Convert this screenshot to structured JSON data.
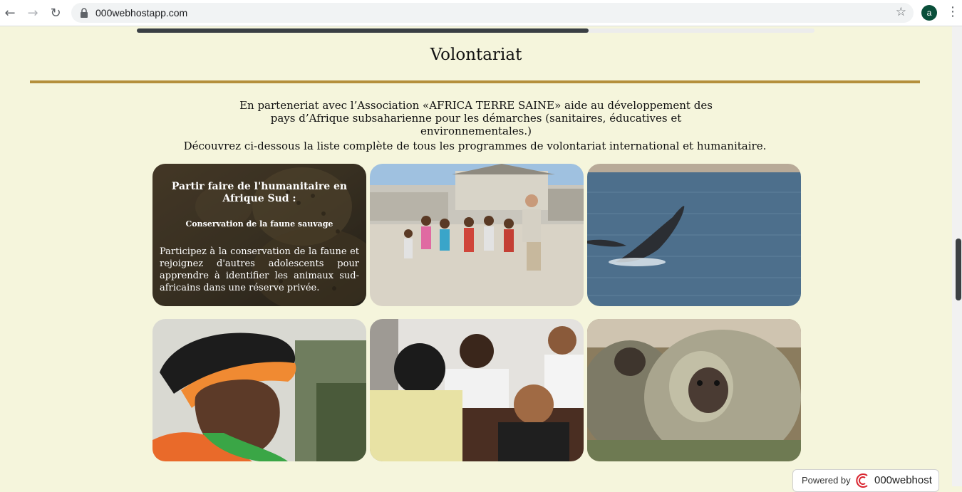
{
  "browser": {
    "back_icon": "←",
    "forward_icon": "→",
    "reload_icon": "↻",
    "url": "000webhostapp.com",
    "star_icon": "☆",
    "profile_initial": "a",
    "menu_icon": "⋮"
  },
  "page": {
    "progress_fraction": 0.667,
    "title": "Volontariat",
    "intro": "En parteneriat avec l’Association «AFRICA TERRE SAINE» aide au développement des pays d’Afrique subsaharienne pour les démarches (sanitaires, éducatives et environnementales.)",
    "discover": "Découvrez ci-dessous la liste complète de tous les programmes de volontariat international et humanitaire."
  },
  "cards": [
    {
      "title": "Partir faire de l'humanitaire en Afrique Sud :",
      "subtitle": "Conservation de la faune sauvage",
      "description": "Participez à la conservation de la faune et rejoignez d'autres adolescents pour apprendre à identifier les animaux sud-africains dans une réserve privée."
    }
  ],
  "footer": {
    "powered_by": "Powered by",
    "brand": "000webhost"
  },
  "colors": {
    "page_background": "#f5f5dc",
    "gold_rule": "#b48f3c",
    "avatar": "#0a4f3a"
  }
}
